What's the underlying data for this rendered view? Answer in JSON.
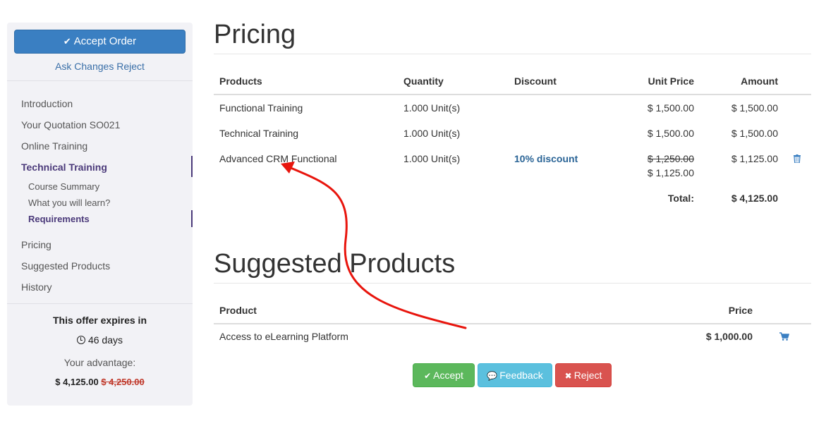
{
  "sidebar": {
    "accept_order": "Accept Order",
    "ask_changes": "Ask Changes",
    "reject": "Reject",
    "nav": [
      {
        "label": "Introduction"
      },
      {
        "label": "Your Quotation SO021"
      },
      {
        "label": "Online Training"
      },
      {
        "label": "Technical Training"
      },
      {
        "label": "Course Summary"
      },
      {
        "label": "What you will learn?"
      },
      {
        "label": "Requirements"
      },
      {
        "label": "Pricing"
      },
      {
        "label": "Suggested Products"
      },
      {
        "label": "History"
      }
    ],
    "offer_expires": "This offer expires in",
    "offer_days": "46 days",
    "advantage_label": "Your advantage:",
    "advantage_price": "$ 4,125.00",
    "advantage_old_price": "$ 4,250.00"
  },
  "pricing": {
    "title": "Pricing",
    "headers": [
      "Products",
      "Quantity",
      "Discount",
      "Unit Price",
      "Amount"
    ],
    "rows": [
      {
        "product": "Functional Training",
        "quantity": "1.000 Unit(s)",
        "discount": "",
        "unit_price": "$ 1,500.00",
        "amount": "$ 1,500.00"
      },
      {
        "product": "Technical Training",
        "quantity": "1.000 Unit(s)",
        "discount": "",
        "unit_price": "$ 1,500.00",
        "amount": "$ 1,500.00"
      },
      {
        "product": "Advanced CRM Functional",
        "quantity": "1.000 Unit(s)",
        "discount": "10% discount",
        "old_unit_price": "$ 1,250.00",
        "unit_price": "$ 1,125.00",
        "amount": "$ 1,125.00"
      }
    ],
    "total_label": "Total:",
    "total": "$ 4,125.00"
  },
  "suggested": {
    "title": "Suggested Products",
    "headers": [
      "Product",
      "Price"
    ],
    "rows": [
      {
        "product": "Access to eLearning Platform",
        "price": "$ 1,000.00"
      }
    ]
  },
  "actions": {
    "accept": "Accept",
    "feedback": "Feedback",
    "reject": "Reject"
  },
  "colors": {
    "primary": "#3a7fc2",
    "success": "#5cb85c",
    "info": "#5bc0de",
    "danger": "#d9534f",
    "annotation_arrow": "#e8150d"
  },
  "icons": [
    "check-icon",
    "clock-icon",
    "trash-icon",
    "cart-icon",
    "comment-icon",
    "close-icon"
  ]
}
